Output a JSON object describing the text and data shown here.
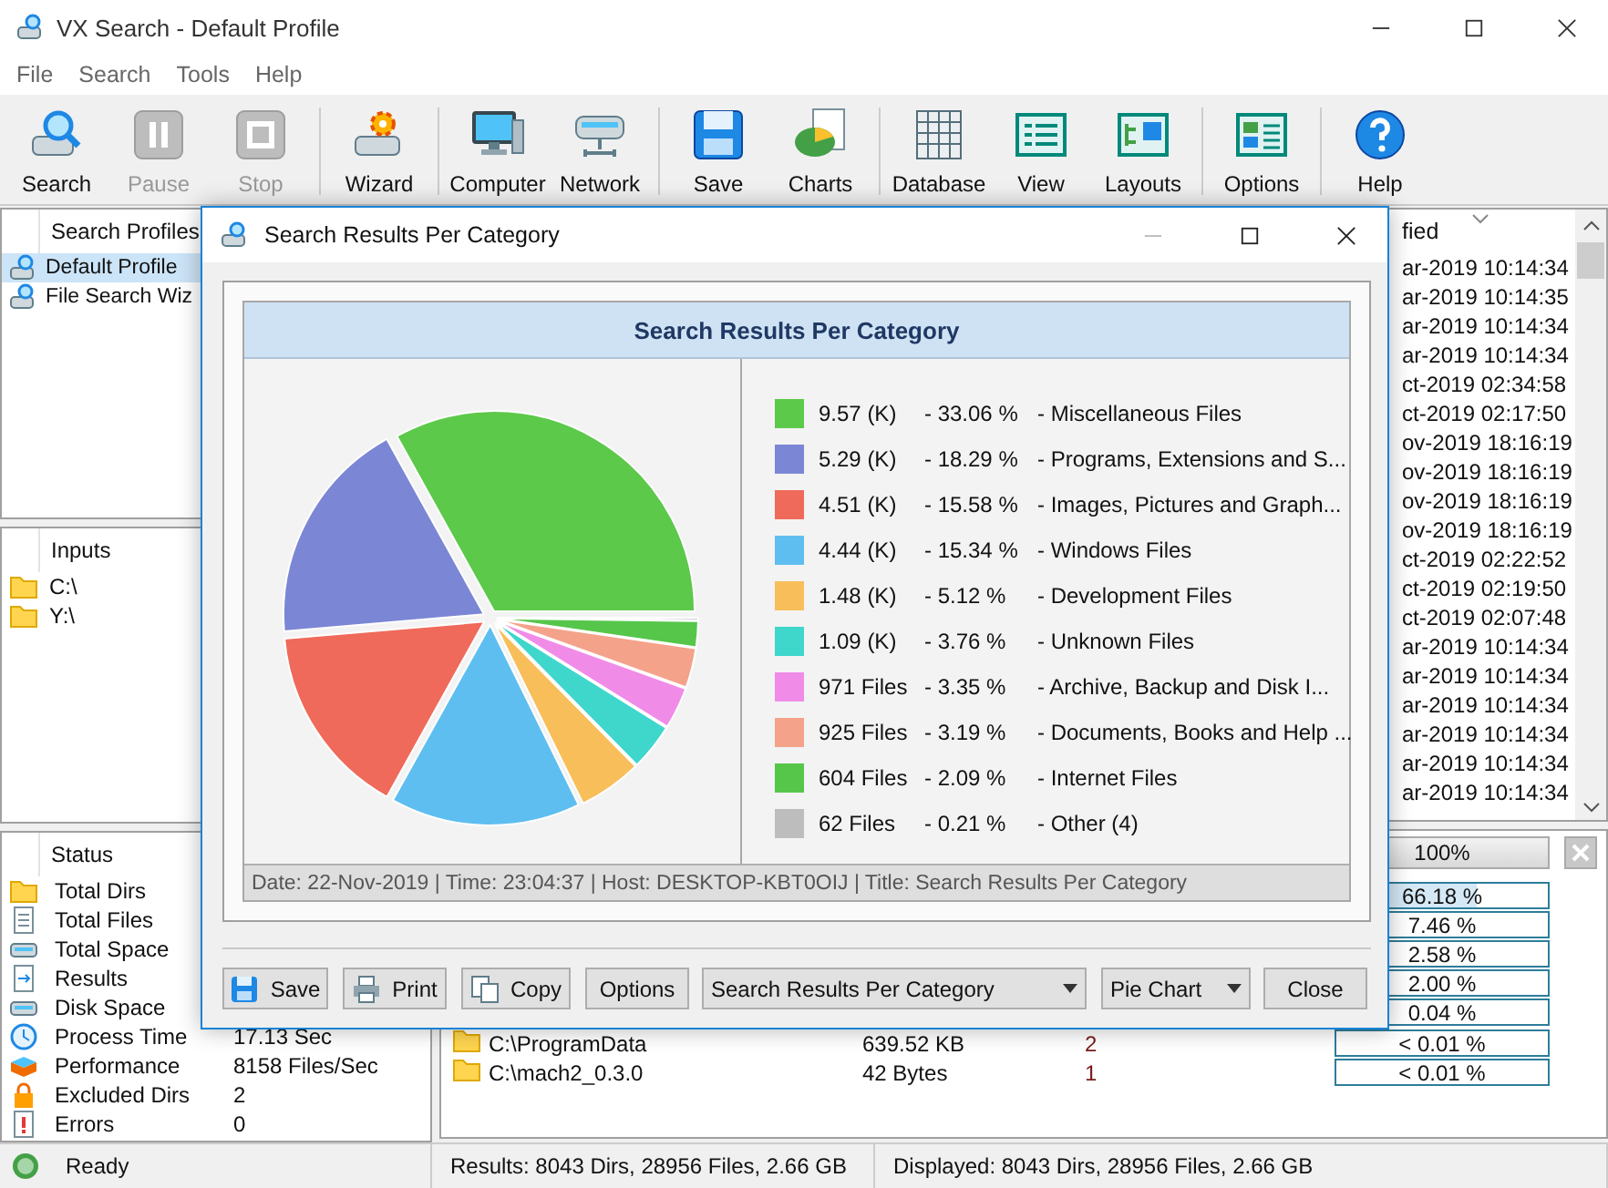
{
  "window": {
    "title": "VX Search - Default Profile"
  },
  "menu": [
    "File",
    "Search",
    "Tools",
    "Help"
  ],
  "toolbar": [
    [
      {
        "label": "Search",
        "disabled": false
      },
      {
        "label": "Pause",
        "disabled": true
      },
      {
        "label": "Stop",
        "disabled": true
      }
    ],
    [
      {
        "label": "Wizard",
        "disabled": false
      }
    ],
    [
      {
        "label": "Computer",
        "disabled": false
      },
      {
        "label": "Network",
        "disabled": false
      }
    ],
    [
      {
        "label": "Save",
        "disabled": false
      },
      {
        "label": "Charts",
        "disabled": false
      }
    ],
    [
      {
        "label": "Database",
        "disabled": false
      },
      {
        "label": "View",
        "disabled": false
      },
      {
        "label": "Layouts",
        "disabled": false
      }
    ],
    [
      {
        "label": "Options",
        "disabled": false
      }
    ],
    [
      {
        "label": "Help",
        "disabled": false
      }
    ]
  ],
  "profiles": {
    "header": "Search Profiles",
    "items": [
      {
        "label": "Default Profile",
        "selected": true
      },
      {
        "label": "File Search Wiz",
        "selected": false
      }
    ]
  },
  "inputs": {
    "header": "Inputs",
    "items": [
      "C:\\",
      "Y:\\"
    ]
  },
  "status": {
    "header": "Status",
    "items": [
      {
        "label": "Total Dirs"
      },
      {
        "label": "Total Files"
      },
      {
        "label": "Total Space"
      },
      {
        "label": "Results"
      },
      {
        "label": "Disk Space"
      },
      {
        "label": "Process Time",
        "value": "17.13 Sec"
      },
      {
        "label": "Performance",
        "value": "8158 Files/Sec"
      },
      {
        "label": "Excluded Dirs",
        "value": "2"
      },
      {
        "label": "Errors",
        "value": "0"
      }
    ]
  },
  "results": {
    "column_header": "fied",
    "dates": [
      "ar-2019 10:14:34",
      "ar-2019 10:14:35",
      "ar-2019 10:14:34",
      "ar-2019 10:14:34",
      "ct-2019 02:34:58",
      "ct-2019 02:17:50",
      "ov-2019 18:16:19",
      "ov-2019 18:16:19",
      "ov-2019 18:16:19",
      "ov-2019 18:16:19",
      "ct-2019 02:22:52",
      "ct-2019 02:19:50",
      "ct-2019 02:07:48",
      "ar-2019 10:14:34",
      "ar-2019 10:14:34",
      "ar-2019 10:14:34",
      "ar-2019 10:14:34",
      "ar-2019 10:14:34",
      "ar-2019 10:14:34"
    ]
  },
  "progress": {
    "text": "100%",
    "level": 1
  },
  "folders": [
    {
      "percent": "66.18 %",
      "level": 0.6618
    },
    {
      "percent": "7.46 %"
    },
    {
      "percent": "2.58 %"
    },
    {
      "percent": "2.00 %"
    },
    {
      "percent": "0.04 %"
    },
    {
      "name": "C:\\ProgramData",
      "size": "639.52 KB",
      "count": "2",
      "percent": "< 0.01 %"
    },
    {
      "name": "C:\\mach2_0.3.0",
      "size": "42 Bytes",
      "count": "1",
      "percent": "< 0.01 %"
    }
  ],
  "status_bar": [
    "Ready",
    "Results: 8043 Dirs, 28956 Files, 2.66 GB",
    "Displayed: 8043 Dirs, 28956 Files, 2.66 GB"
  ],
  "dialog": {
    "title": "Search Results Per Category",
    "chart_data": {
      "type": "pie",
      "title": "Search Results Per Category",
      "values": [
        33.06,
        18.29,
        15.58,
        15.34,
        5.12,
        3.76,
        3.35,
        3.19,
        2.09,
        0.21
      ]
    },
    "legend": [
      {
        "count": "9.57 (K)",
        "percent": "- 33.06 %",
        "label": "- Miscellaneous Files",
        "color": "#5cc94a"
      },
      {
        "count": "5.29 (K)",
        "percent": "- 18.29 %",
        "label": "- Programs, Extensions and S...",
        "color": "#7b86d4"
      },
      {
        "count": "4.51 (K)",
        "percent": "- 15.58 %",
        "label": "- Images, Pictures and Graph...",
        "color": "#ef6a5a"
      },
      {
        "count": "4.44 (K)",
        "percent": "- 15.34 %",
        "label": "- Windows Files",
        "color": "#5fbef0"
      },
      {
        "count": "1.48 (K)",
        "percent": "- 5.12 %",
        "label": "- Development Files",
        "color": "#f8be5a"
      },
      {
        "count": "1.09 (K)",
        "percent": "- 3.76 %",
        "label": "- Unknown Files",
        "color": "#3fd6cc"
      },
      {
        "count": "971 Files",
        "percent": "- 3.35 %",
        "label": "- Archive, Backup and Disk I...",
        "color": "#f08ce8"
      },
      {
        "count": "925 Files",
        "percent": "- 3.19 %",
        "label": "- Documents, Books and Help ...",
        "color": "#f4a28a"
      },
      {
        "count": "604 Files",
        "percent": "- 2.09 %",
        "label": "- Internet Files",
        "color": "#55c64a"
      },
      {
        "count": "62 Files",
        "percent": "- 0.21 %",
        "label": "- Other (4)",
        "color": "#bdbdbd"
      }
    ],
    "footer": "Date: 22-Nov-2019 | Time: 23:04:37 | Host: DESKTOP-KBT0OIJ | Title: Search Results Per Category",
    "buttons": [
      {
        "kind": "button",
        "label": "Save"
      },
      {
        "kind": "button",
        "label": "Print"
      },
      {
        "kind": "button",
        "label": "Copy"
      },
      {
        "kind": "button",
        "label": "Options"
      },
      {
        "kind": "dropdown",
        "label": "Search Results Per Category"
      },
      {
        "kind": "dropdown",
        "label": "Pie Chart"
      },
      {
        "kind": "button",
        "label": "Close"
      }
    ]
  }
}
